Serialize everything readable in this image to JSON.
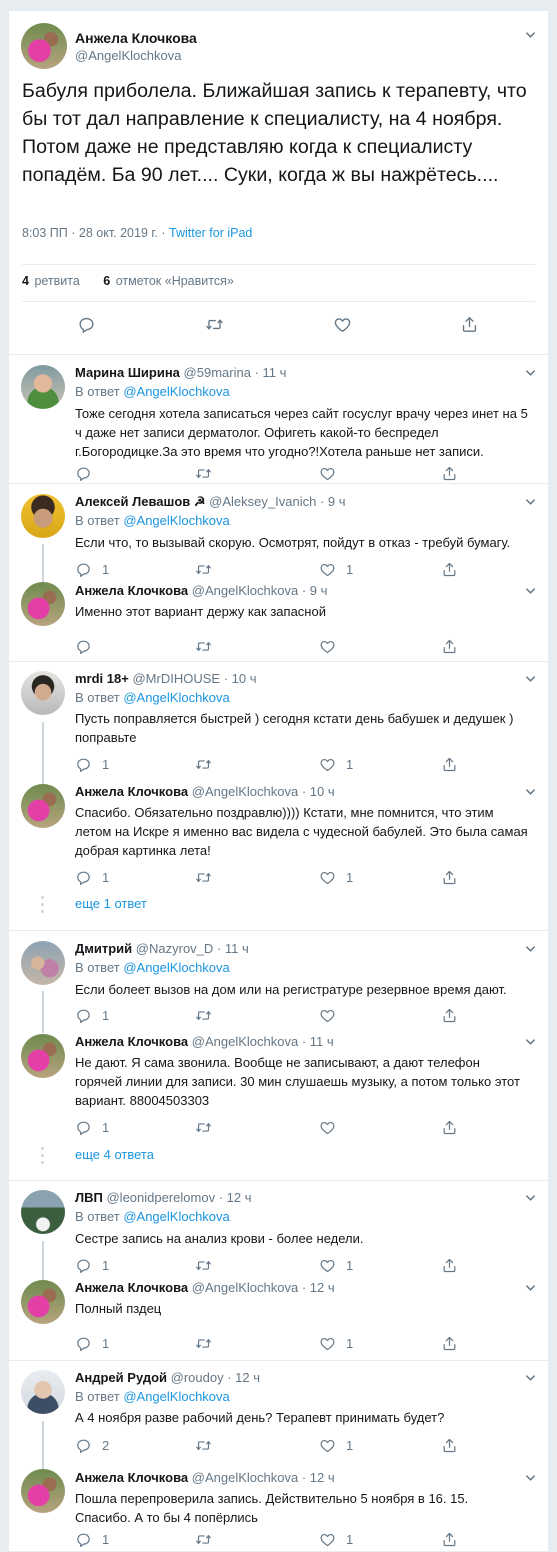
{
  "main": {
    "name": "Анжела Клочкова",
    "handle": "@AngelKlochkova",
    "text": "Бабуля приболела. Ближайшая запись к терапевту, что бы тот дал направление к специалисту, на 4 ноября. Потом даже не представляю когда к специалисту попадём. Ба 90 лет.... Суки, когда ж вы нажрётесь....",
    "time": "8:03 ПП · 28 окт. 2019 г. · ",
    "source": "Twitter for iPad",
    "retweets_count": "4",
    "retweets_label": "ретвита",
    "likes_count": "6",
    "likes_label": "отметок «Нравится»"
  },
  "in_reply_prefix": "В ответ",
  "in_reply_to": "@AngelKlochkova",
  "replies": [
    {
      "name": "Марина Ширина",
      "handle": "@59marina",
      "time": "· 11 ч",
      "text": "Тоже сегодня хотела записаться через сайт госуслуг врачу через инет на 5 ч даже нет записи дерматолог. Офигеть какой-то беспредел г.Богородицке.За это время что угодно?!Хотела раньше нет записи.",
      "reply_count": "",
      "retweet_count": "",
      "like_count": ""
    },
    {
      "name": "Алексей Левашов ☭",
      "handle": "@Aleksey_Ivanich",
      "time": "· 9 ч",
      "text": "Если что, то вызывай скорую. Осмотрят, пойдут в отказ - требуй бумагу.",
      "reply_count": "1",
      "retweet_count": "",
      "like_count": "1"
    },
    {
      "name": "Анжела Клочкова",
      "handle": "@AngelKlochkova",
      "time": "· 9 ч",
      "text": "Именно этот вариант держу как запасной",
      "reply_count": "",
      "retweet_count": "",
      "like_count": ""
    },
    {
      "name": "mrdi 18+",
      "handle": "@MrDIHOUSE",
      "time": "· 10 ч",
      "text": "Пусть поправляется быстрей ) сегодня кстати день бабушек и дедушек ) поправьте",
      "reply_count": "1",
      "retweet_count": "",
      "like_count": "1"
    },
    {
      "name": "Анжела Клочкова",
      "handle": "@AngelKlochkova",
      "time": "· 10 ч",
      "text": "Спасибо. Обязательно поздравлю)))) Кстати, мне помнится, что этим летом на Искре я именно вас видела с чудесной бабулей. Это была самая добрая картинка лета!",
      "reply_count": "1",
      "retweet_count": "",
      "like_count": "1"
    },
    {
      "name": "Дмитрий",
      "handle": "@Nazyrov_D",
      "time": "· 11 ч",
      "text": "Если болеет вызов на дом или на регистратуре резервное время дают.",
      "reply_count": "1",
      "retweet_count": "",
      "like_count": ""
    },
    {
      "name": "Анжела Клочкова",
      "handle": "@AngelKlochkova",
      "time": "· 11 ч",
      "text": "Не дают. Я сама звонила. Вообще не записывают, а дают телефон горячей линии для записи. 30 мин слушаешь музыку, а потом только этот вариант. 88004503303",
      "reply_count": "1",
      "retweet_count": "",
      "like_count": ""
    },
    {
      "name": "ЛВП",
      "handle": "@leonidperelomov",
      "time": "· 12 ч",
      "text": "Сестре запись на анализ крови - более недели.",
      "reply_count": "1",
      "retweet_count": "",
      "like_count": "1"
    },
    {
      "name": "Анжела Клочкова",
      "handle": "@AngelKlochkova",
      "time": "· 12 ч",
      "text": "Полный пздец",
      "reply_count": "1",
      "retweet_count": "",
      "like_count": "1"
    },
    {
      "name": "Андрей Рудой",
      "handle": "@roudoy",
      "time": "· 12 ч",
      "text": "А 4 ноября разве рабочий день? Терапевт принимать будет?",
      "reply_count": "2",
      "retweet_count": "",
      "like_count": "1"
    },
    {
      "name": "Анжела Клочкова",
      "handle": "@AngelKlochkova",
      "time": "· 12 ч",
      "text": "Пошла перепроверила запись. Действительно 5 ноября в 16. 15. Спасибо. А то бы 4 попёрлись",
      "reply_count": "1",
      "retweet_count": "",
      "like_count": "1"
    }
  ],
  "more_replies": [
    "еще 1 ответ",
    "еще 4 ответа"
  ],
  "icons": {
    "reply": "reply-icon",
    "retweet": "retweet-icon",
    "like": "heart-icon",
    "share": "share-icon",
    "caret": "chevron-down-icon"
  },
  "colors": {
    "link": "#1b95e0",
    "muted": "#657786",
    "text": "#14171a",
    "border": "#e6ecf0"
  }
}
